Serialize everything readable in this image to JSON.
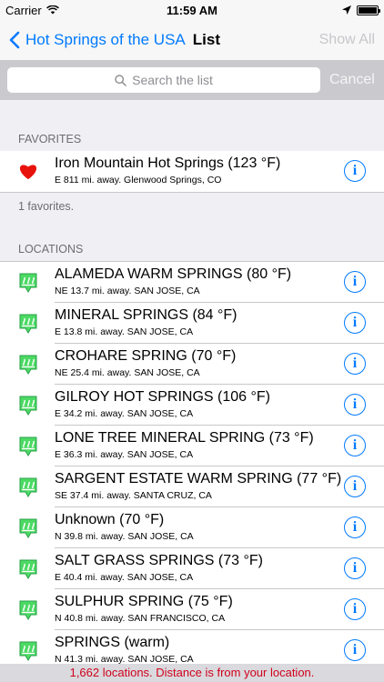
{
  "status_bar": {
    "carrier": "Carrier",
    "time": "11:59 AM"
  },
  "nav": {
    "back_label": "Hot Springs of the USA",
    "title": "List",
    "right_label": "Show All"
  },
  "search": {
    "placeholder": "Search the list",
    "cancel_label": "Cancel"
  },
  "favorites": {
    "header": "FAVORITES",
    "items": [
      {
        "title": "Iron Mountain Hot Springs (123 °F)",
        "subtitle": "E 811 mi. away.  Glenwood Springs, CO"
      }
    ],
    "footer": "1 favorites."
  },
  "locations": {
    "header": "LOCATIONS",
    "items": [
      {
        "title": "ALAMEDA WARM SPRINGS (80 °F)",
        "subtitle": "NE 13.7 mi. away.  SAN JOSE, CA"
      },
      {
        "title": "MINERAL SPRINGS (84 °F)",
        "subtitle": "E 13.8 mi. away.  SAN JOSE, CA"
      },
      {
        "title": "CROHARE SPRING (70 °F)",
        "subtitle": "NE 25.4 mi. away.  SAN JOSE, CA"
      },
      {
        "title": "GILROY HOT SPRINGS (106 °F)",
        "subtitle": "E 34.2 mi. away.  SAN JOSE, CA"
      },
      {
        "title": "LONE TREE MINERAL SPRING (73 °F)",
        "subtitle": "E 36.3 mi. away.  SAN JOSE, CA"
      },
      {
        "title": "SARGENT ESTATE WARM SPRING (77 °F)",
        "subtitle": "SE 37.4 mi. away.  SANTA CRUZ, CA"
      },
      {
        "title": "Unknown (70 °F)",
        "subtitle": "N 39.8 mi. away.  SAN JOSE, CA"
      },
      {
        "title": "SALT GRASS SPRINGS (73 °F)",
        "subtitle": "E 40.4 mi. away.  SAN JOSE, CA"
      },
      {
        "title": "SULPHUR SPRING (75 °F)",
        "subtitle": "N 40.8 mi. away.  SAN FRANCISCO, CA"
      },
      {
        "title": "SPRINGS (warm)",
        "subtitle": "N 41.3 mi. away.  SAN JOSE, CA"
      }
    ]
  },
  "bottom_banner": "1,662 locations. Distance is from your location.",
  "colors": {
    "accent": "#007aff",
    "favorite": "#e8120c",
    "spring_icon": "#4cd964",
    "banner_text": "#d0021b"
  },
  "icons": {
    "favorite": "heart-icon",
    "location": "hot-spring-icon",
    "info": "info-icon"
  }
}
